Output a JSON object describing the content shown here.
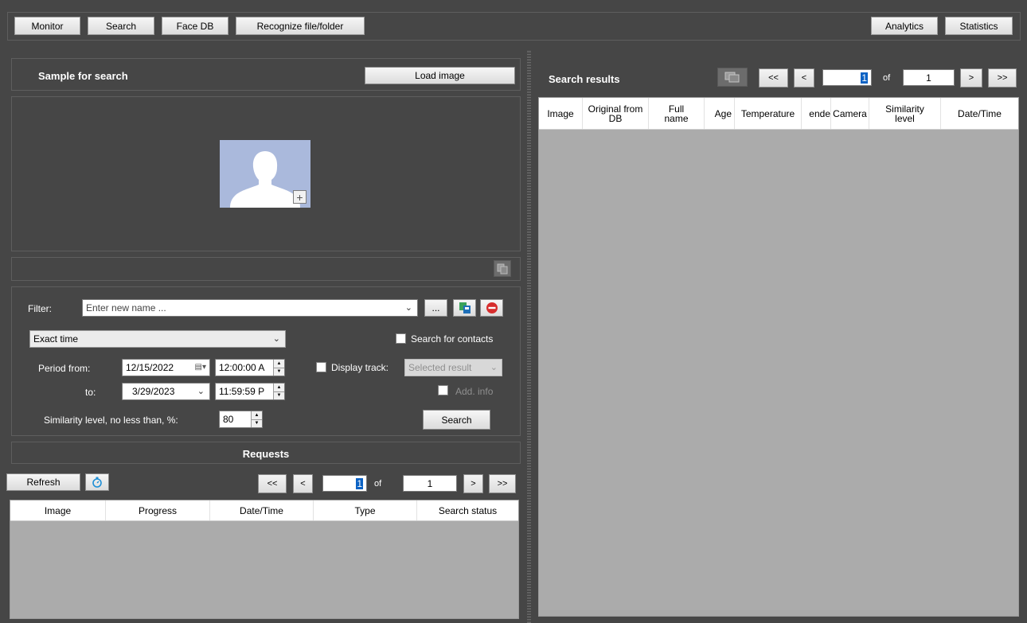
{
  "nav": {
    "monitor": "Monitor",
    "search": "Search",
    "face_db": "Face DB",
    "recognize": "Recognize file/folder",
    "analytics": "Analytics",
    "statistics": "Statistics"
  },
  "sample": {
    "title": "Sample for search",
    "load_image": "Load image"
  },
  "filter": {
    "label": "Filter:",
    "name_placeholder": "Enter new name ...",
    "browse": "...",
    "time_mode": "Exact time",
    "search_contacts": "Search for contacts",
    "period_from_label": "Period from:",
    "from_date": "12/15/2022",
    "from_time": "12:00:00 A",
    "to_label": "to:",
    "to_date": "3/29/2023",
    "to_time": "11:59:59 P",
    "display_track": "Display track:",
    "track_select": "Selected result",
    "add_info": "Add. info",
    "similarity_label": "Similarity level, no less than, %:",
    "similarity_value": "80",
    "search_button": "Search"
  },
  "requests": {
    "title": "Requests",
    "refresh": "Refresh",
    "pager": {
      "first": "<<",
      "prev": "<",
      "page": "1",
      "of": "of",
      "total": "1",
      "next": ">",
      "last": ">>"
    },
    "columns": [
      "Image",
      "Progress",
      "Date/Time",
      "Type",
      "Search status"
    ]
  },
  "results": {
    "title": "Search results",
    "pager": {
      "first": "<<",
      "prev": "<",
      "page": "1",
      "of": "of",
      "total": "1",
      "next": ">",
      "last": ">>"
    },
    "columns": {
      "image": "Image",
      "original": "Original from DB",
      "full_name": "Full name",
      "age": "Age",
      "temperature": "Temperature",
      "gender": "ende",
      "camera": "Camera",
      "similarity": "Similarity level",
      "datetime": "Date/Time"
    }
  },
  "colors": {
    "app_bg": "#464646",
    "grid_bg": "#ababab",
    "selection": "#0b62c4",
    "avatar_bg": "#aab9dc"
  }
}
